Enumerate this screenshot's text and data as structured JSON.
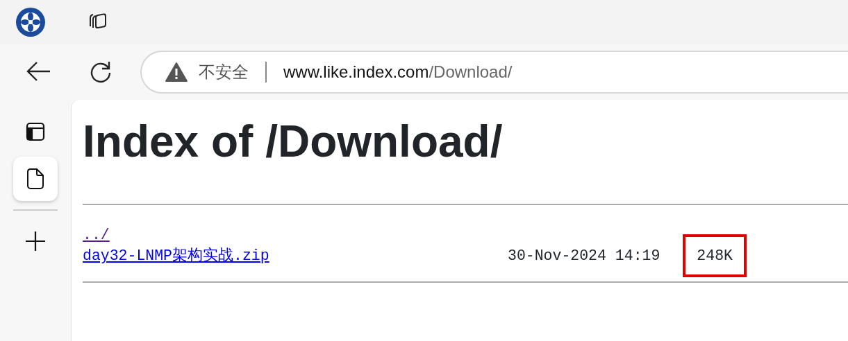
{
  "browser": {
    "security_label": "不安全",
    "url_host": "www.like.index.com",
    "url_path": "/Download/"
  },
  "sidebar": {
    "tabs": [
      {
        "kind": "layout",
        "selected": false
      },
      {
        "kind": "page",
        "selected": true
      },
      {
        "kind": "new",
        "selected": false
      }
    ]
  },
  "page": {
    "heading": "Index of /Download/",
    "entries": [
      {
        "name": "../",
        "visited": true
      },
      {
        "name": "day32-LNMP架构实战.zip",
        "visited": false,
        "date": "30-Nov-2024 14:19",
        "size": "248K",
        "highlighted": true
      }
    ]
  }
}
